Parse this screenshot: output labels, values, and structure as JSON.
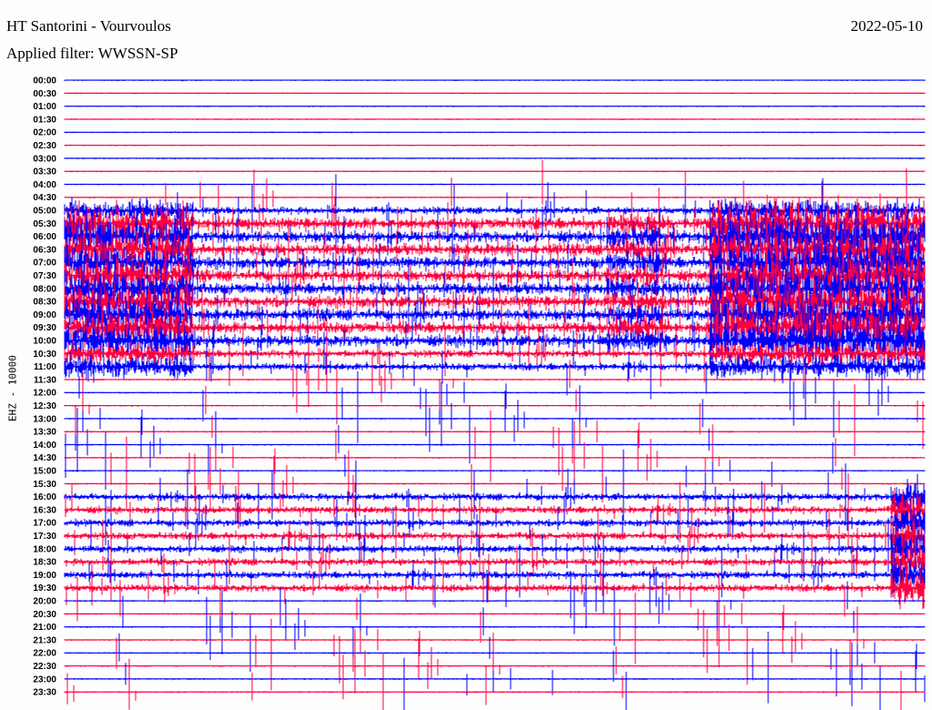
{
  "header": {
    "title": "HT Santorini - Vourvoulos",
    "date": "2022-05-10",
    "filter": "Applied filter: WWSSN-SP"
  },
  "chart_data": {
    "type": "line",
    "title": "HT Santorini - Vourvoulos",
    "subtitle": "Applied filter: WWSSN-SP",
    "ylabel": "EHZ - 10000",
    "xlabel": "",
    "minutes_per_row": 30,
    "trace_colors": [
      "#0000ff",
      "#ff0040"
    ],
    "row_labels": [
      "00:00",
      "00:30",
      "01:00",
      "01:30",
      "02:00",
      "02:30",
      "03:00",
      "03:30",
      "04:00",
      "04:30",
      "05:00",
      "05:30",
      "06:00",
      "06:30",
      "07:00",
      "07:30",
      "08:00",
      "08:30",
      "09:00",
      "09:30",
      "10:00",
      "10:30",
      "11:00",
      "11:30",
      "12:00",
      "12:30",
      "13:00",
      "13:30",
      "14:00",
      "14:30",
      "15:00",
      "15:30",
      "16:00",
      "16:30",
      "17:00",
      "17:30",
      "18:00",
      "18:30",
      "19:00",
      "19:30",
      "20:00",
      "20:30",
      "21:00",
      "21:30",
      "22:00",
      "22:30",
      "23:00",
      "23:30"
    ],
    "activity_levels": [
      0,
      0,
      0,
      0,
      0,
      0,
      0,
      0,
      0,
      1,
      2,
      3,
      3,
      3,
      3,
      3,
      3,
      3,
      3,
      3,
      3,
      2,
      2,
      1,
      1,
      1,
      1,
      1,
      1,
      1,
      1,
      1,
      2,
      2,
      2,
      2,
      2,
      2,
      2,
      2,
      1,
      1,
      1,
      1,
      1,
      1,
      1,
      1
    ]
  }
}
